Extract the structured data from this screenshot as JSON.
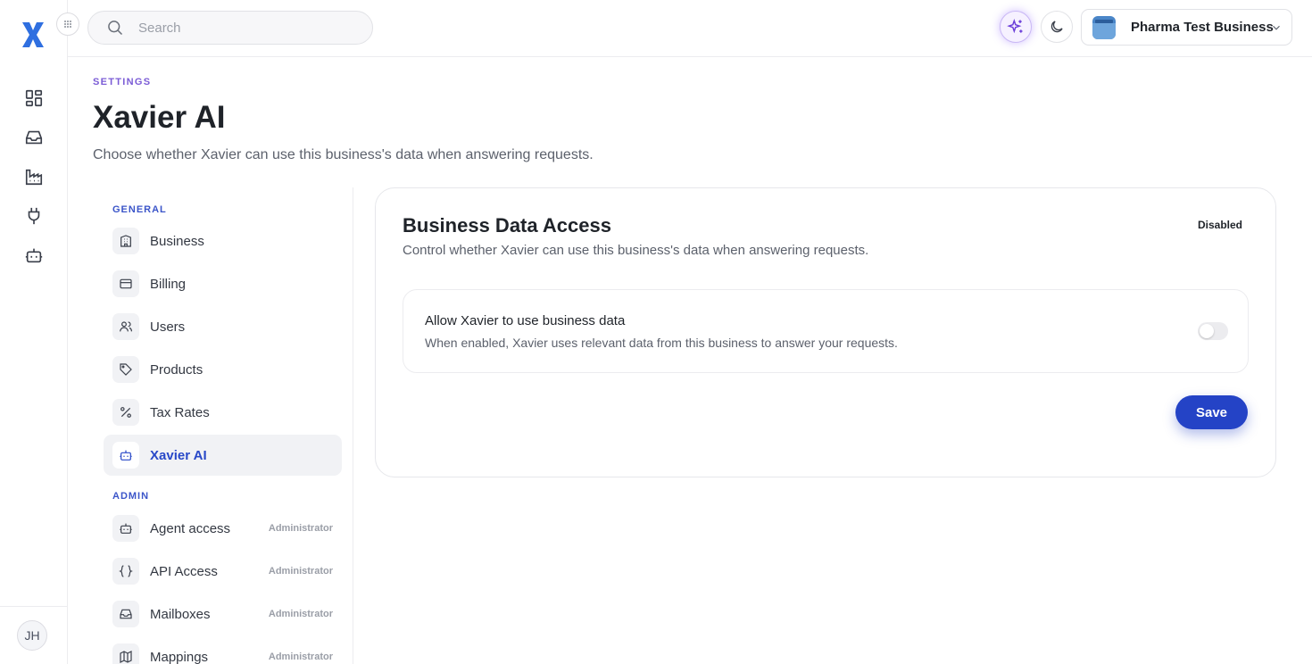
{
  "colors": {
    "accent": "#2443c6",
    "eyebrow": "#7b5cd6",
    "section": "#3b55c9",
    "ai_glow": "#966eff"
  },
  "rail": {
    "logo_icon": "x-logo-icon",
    "toggle_icon": "grip-dots-icon",
    "items": [
      {
        "icon": "dashboard-icon"
      },
      {
        "icon": "inbox-icon"
      },
      {
        "icon": "factory-icon"
      },
      {
        "icon": "plug-icon"
      },
      {
        "icon": "bot-icon"
      }
    ],
    "avatar_initials": "JH"
  },
  "topbar": {
    "search_placeholder": "Search",
    "ai_icon": "sparkles-icon",
    "theme_icon": "moon-icon",
    "business_name": "Pharma Test Business"
  },
  "header": {
    "eyebrow": "SETTINGS",
    "title": "Xavier AI",
    "subtitle": "Choose whether Xavier can use this business's data when answering requests."
  },
  "nav": {
    "general_label": "GENERAL",
    "admin_label": "ADMIN",
    "general": [
      {
        "label": "Business",
        "icon": "building-icon"
      },
      {
        "label": "Billing",
        "icon": "credit-card-icon"
      },
      {
        "label": "Users",
        "icon": "users-icon"
      },
      {
        "label": "Products",
        "icon": "tag-icon"
      },
      {
        "label": "Tax Rates",
        "icon": "percent-icon"
      },
      {
        "label": "Xavier AI",
        "icon": "bot-icon",
        "active": true
      }
    ],
    "admin": [
      {
        "label": "Agent access",
        "role": "Administrator",
        "icon": "bot-icon"
      },
      {
        "label": "API Access",
        "role": "Administrator",
        "icon": "braces-icon"
      },
      {
        "label": "Mailboxes",
        "role": "Administrator",
        "icon": "inbox-icon"
      },
      {
        "label": "Mappings",
        "role": "Administrator",
        "icon": "map-icon"
      }
    ]
  },
  "card": {
    "title": "Business Data Access",
    "subtitle": "Control whether Xavier can use this business's data when answering requests.",
    "status": "Disabled",
    "toggle_title": "Allow Xavier to use business data",
    "toggle_desc": "When enabled, Xavier uses relevant data from this business to answer your requests.",
    "toggle_enabled": false,
    "save_label": "Save"
  }
}
